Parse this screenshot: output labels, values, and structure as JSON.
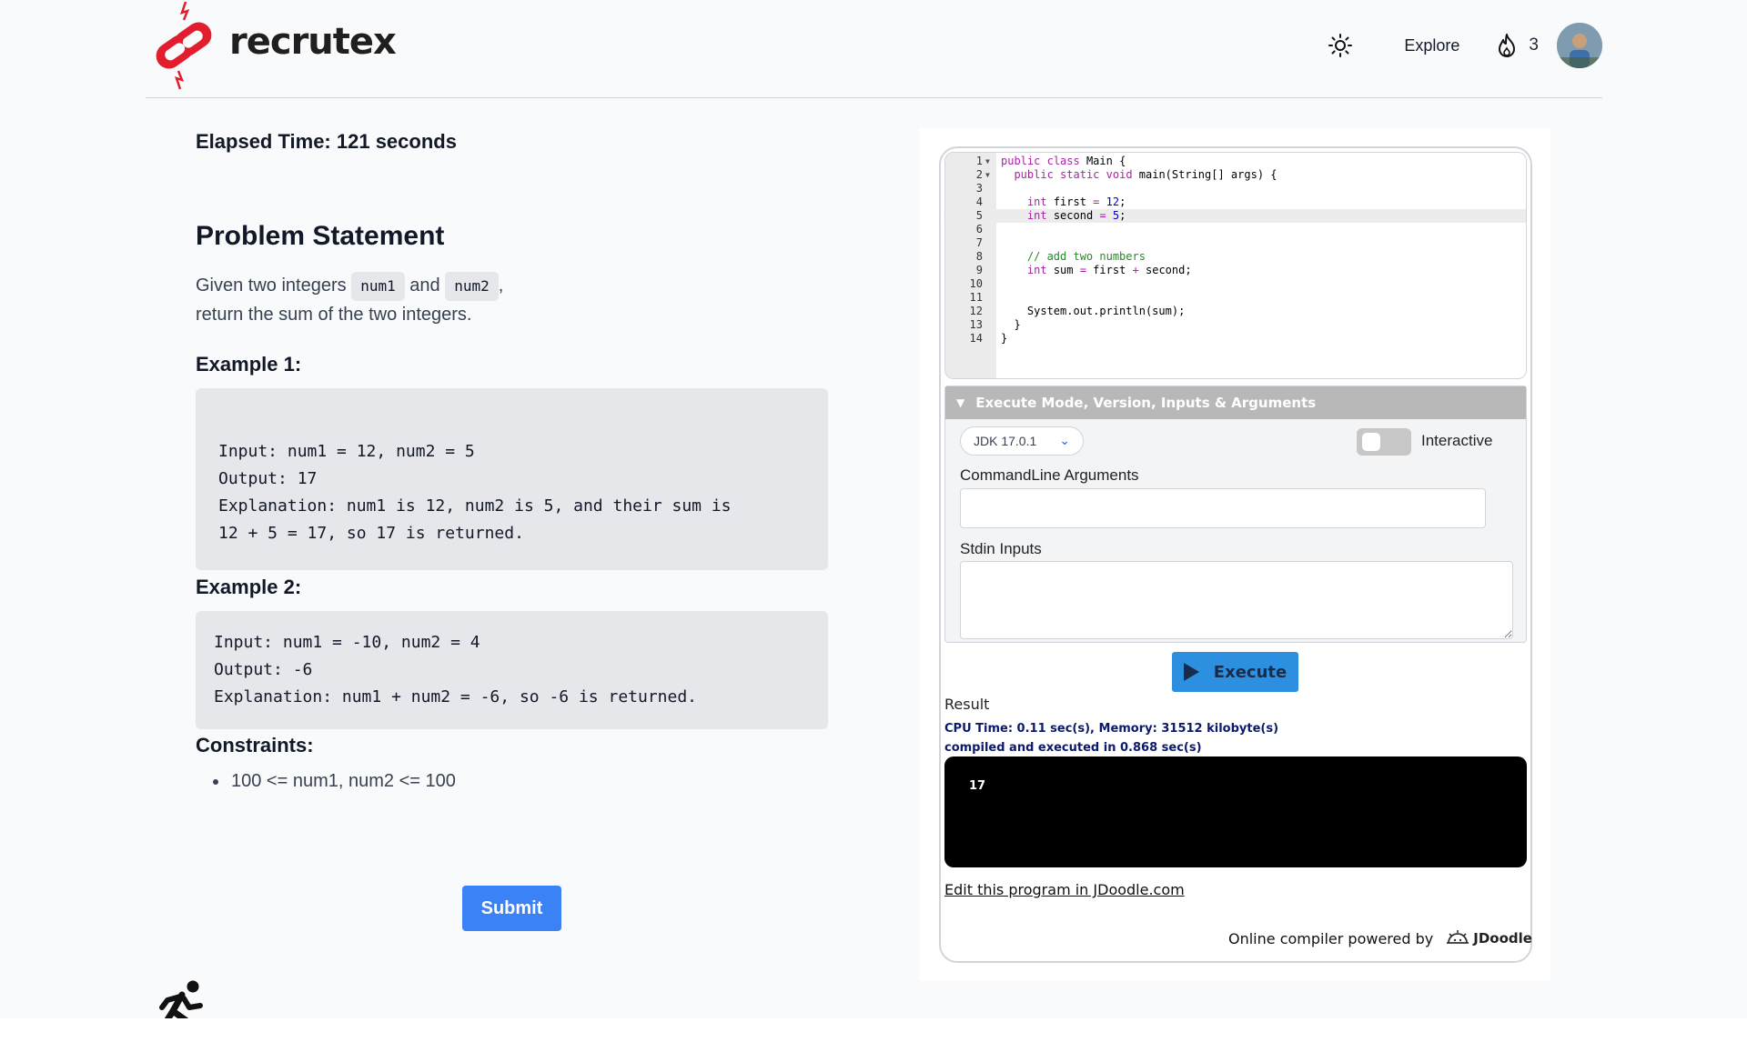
{
  "header": {
    "logo_text": "recrutex",
    "explore_label": "Explore",
    "streak_count": "3"
  },
  "problem": {
    "elapsed": "Elapsed Time: 121 seconds",
    "title": "Problem Statement",
    "desc_before": "Given two integers",
    "var1": "num1",
    "and": "and",
    "var2": "num2",
    "desc_comma": ",",
    "desc_line2": "return the sum of the two integers.",
    "example1_title": "Example 1:",
    "example1_lines": [
      "Input: num1 = 12, num2 = 5",
      "Output: 17",
      "Explanation: num1 is 12, num2 is 5, and their sum is",
      "12 + 5 = 17, so 17 is returned."
    ],
    "example2_title": "Example 2:",
    "example2_lines": [
      "Input: num1 = -10, num2 = 4",
      "Output: -6",
      "Explanation: num1 + num2 = -6, so -6 is returned."
    ],
    "constraints_title": "Constraints:",
    "constraint_1": "100 <= num1, num2 <= 100",
    "submit_label": "Submit"
  },
  "editor": {
    "line_numbers": [
      "1",
      "2",
      "3",
      "4",
      "5",
      "6",
      "7",
      "8",
      "9",
      "10",
      "11",
      "12",
      "13",
      "14"
    ],
    "active_line": 5
  },
  "jdoodle": {
    "panel_title": "Execute Mode, Version, Inputs & Arguments",
    "jdk_version": "JDK 17.0.1",
    "interactive_label": "Interactive",
    "interactive_on": false,
    "args_label": "CommandLine Arguments",
    "args_value": "",
    "stdin_label": "Stdin Inputs",
    "stdin_value": "",
    "execute_label": "Execute",
    "result_label": "Result",
    "stats_line1": "CPU Time: 0.11 sec(s), Memory: 31512 kilobyte(s)",
    "stats_line2": "compiled and executed in 0.868 sec(s)",
    "output": "17",
    "edit_link": "Edit this program in JDoodle.com",
    "powered_by": "Online compiler powered by",
    "brand": "JDoodle"
  },
  "colors": {
    "submit": "#3b82f6",
    "execute": "#2d8fe0",
    "logo_red": "#e11d2e",
    "stats_text": "#0b1a6b"
  }
}
